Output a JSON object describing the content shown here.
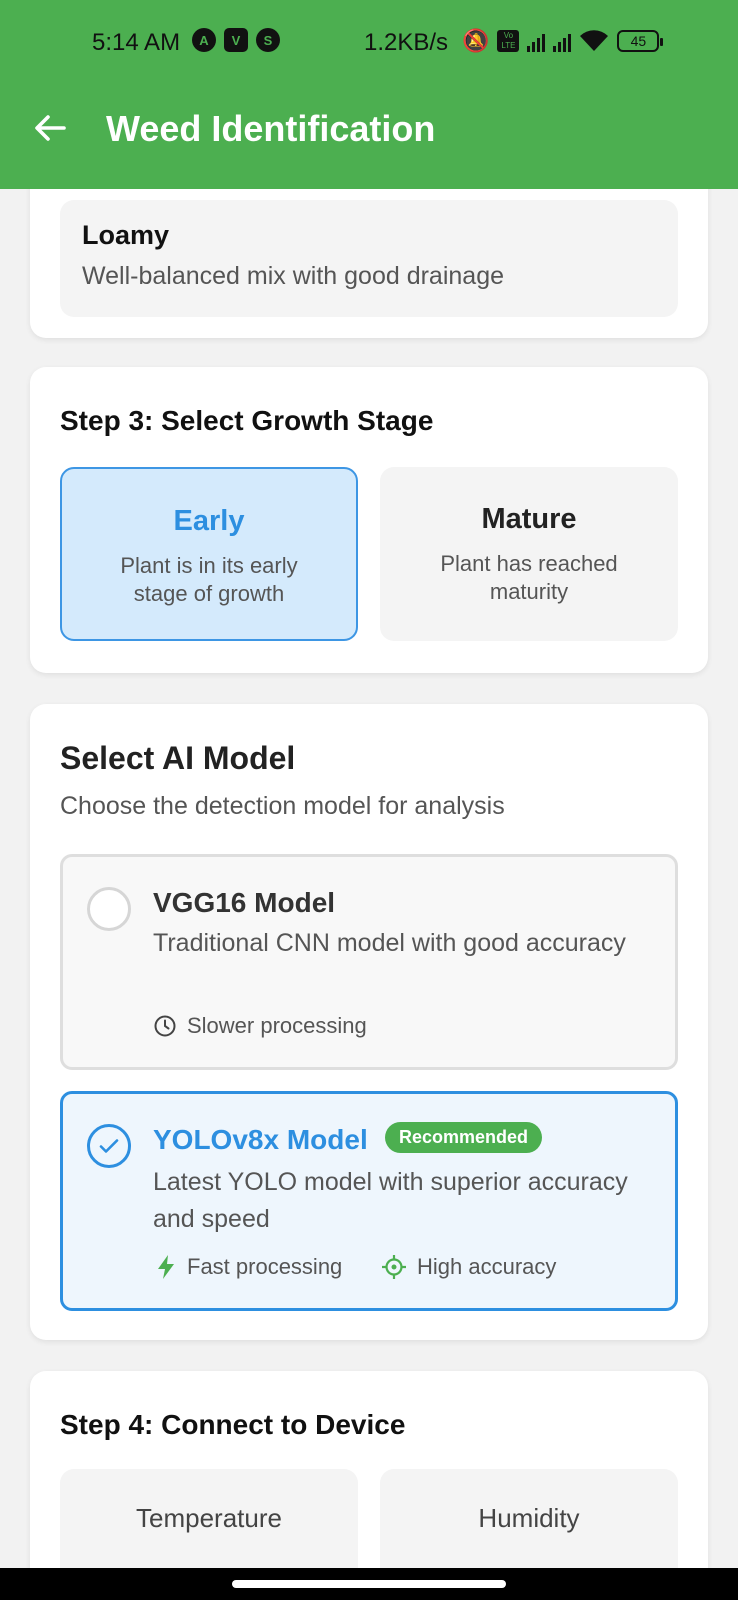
{
  "status": {
    "time": "5:14 AM",
    "speed": "1.2KB/s",
    "battery": "45",
    "left_icons": [
      "A",
      "V",
      "S"
    ]
  },
  "header": {
    "title": "Weed Identification"
  },
  "soil": {
    "selected_name": "Loamy",
    "selected_desc": "Well-balanced mix with good drainage"
  },
  "growth": {
    "title": "Step 3: Select Growth Stage",
    "options": [
      {
        "name": "Early",
        "desc": "Plant is in its early stage of growth",
        "selected": true
      },
      {
        "name": "Mature",
        "desc": "Plant has reached maturity",
        "selected": false
      }
    ]
  },
  "model": {
    "title": "Select AI Model",
    "subtitle": "Choose the detection model for analysis",
    "options": [
      {
        "name": "VGG16 Model",
        "desc": "Traditional CNN model with good accuracy",
        "features": [
          {
            "icon": "clock-icon",
            "label": "Slower processing"
          }
        ],
        "selected": false
      },
      {
        "name": "YOLOv8x Model",
        "badge": "Recommended",
        "desc": "Latest YOLO model with superior accuracy and speed",
        "features": [
          {
            "icon": "bolt-icon",
            "label": "Fast processing"
          },
          {
            "icon": "crosshair-icon",
            "label": "High accuracy"
          }
        ],
        "selected": true
      }
    ]
  },
  "device": {
    "title": "Step 4: Connect to Device",
    "sensors": [
      {
        "label": "Temperature"
      },
      {
        "label": "Humidity"
      }
    ]
  },
  "colors": {
    "primary_green": "#4caf50",
    "accent_blue": "#2d8fe0",
    "selected_bg": "#d4eafc"
  }
}
